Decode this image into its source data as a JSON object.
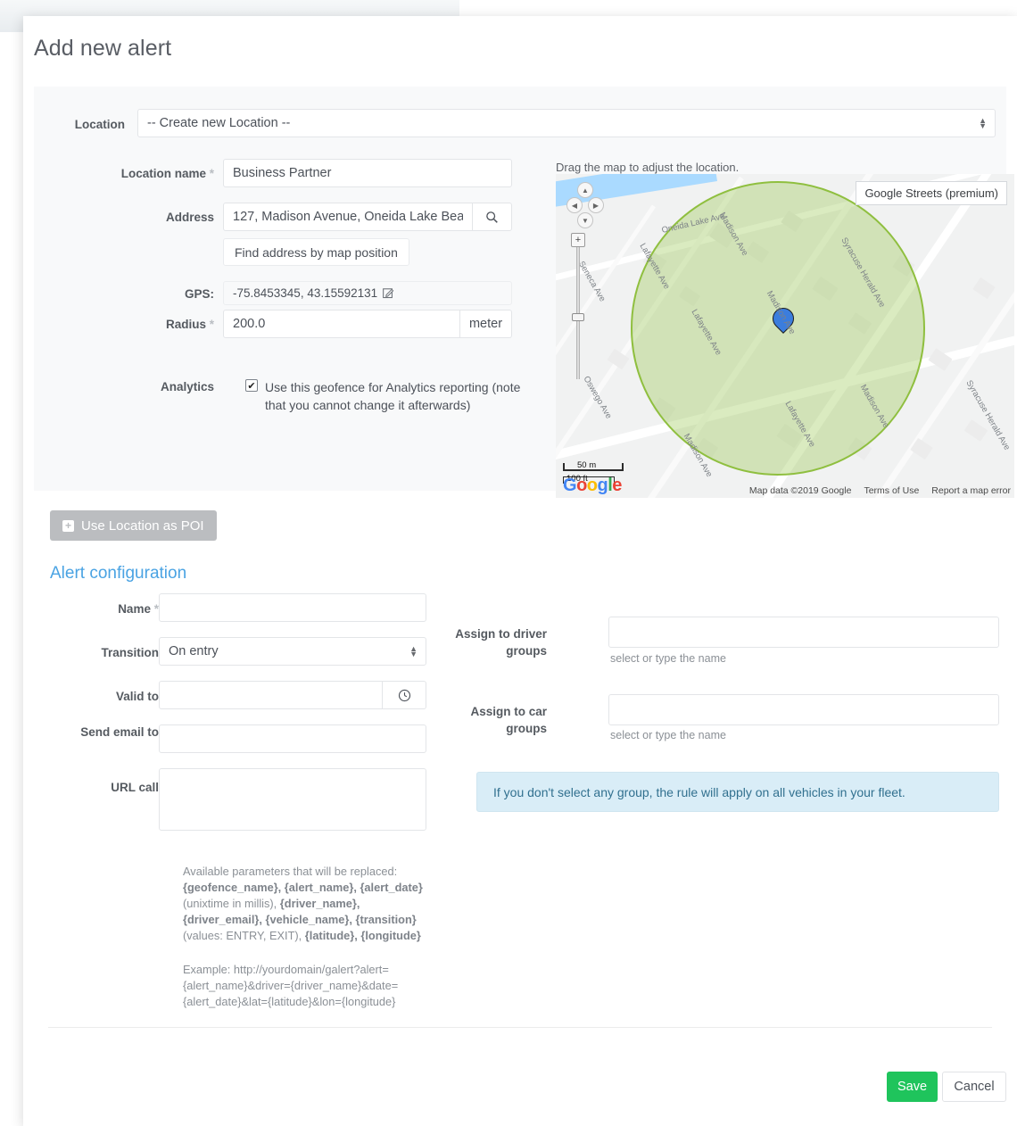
{
  "modal": {
    "title": "Add new alert"
  },
  "location_section": {
    "location_label": "Location",
    "location_select_value": "-- Create new Location --",
    "location_name_label": "Location name",
    "location_name_value": "Business Partner",
    "address_label": "Address",
    "address_value": "127, Madison Avenue, Oneida Lake Bea",
    "find_address_button": "Find address by map position",
    "gps_label": "GPS:",
    "gps_value": "-75.8453345, 43.15592131",
    "radius_label": "Radius",
    "radius_value": "200.0",
    "radius_unit": "meter",
    "analytics_label": "Analytics",
    "analytics_checkbox_checked": "✔",
    "analytics_text": "Use this geofence for Analytics reporting (note that you cannot change it afterwards)",
    "required_marker": "*"
  },
  "map": {
    "hint": "Drag the map to adjust the location.",
    "map_type": "Google Streets (premium)",
    "scale_metric": "50 m",
    "scale_imperial": "100 ft",
    "attribution": "Map data ©2019 Google",
    "terms": "Terms of Use",
    "report": "Report a map error",
    "logo_letters": [
      "G",
      "o",
      "o",
      "g",
      "l",
      "e"
    ],
    "street_labels": [
      "Oneida Lake Ave",
      "Madison Ave",
      "Syracuse Herald Ave",
      "Lafayette Ave",
      "Lafayette Ave",
      "Seneca Ave",
      "Oswego Ave",
      "Madison Ave",
      "Lafayette Ave",
      "Madison Ave",
      "Syracuse Herald Ave",
      "Madison Ave"
    ],
    "circle_fill": "#94c74b",
    "circle_stroke": "#8fbf3f",
    "pin_color": "#3b7ddd",
    "pan_up": "▲",
    "pan_left": "◀",
    "pan_right": "▶",
    "pan_down": "▼",
    "zoom_in": "+"
  },
  "poi_button": {
    "label": "Use Location as POI",
    "icon": "+"
  },
  "alert_config": {
    "section_title": "Alert configuration",
    "name_label": "Name",
    "name_value": "",
    "transition_label": "Transition",
    "transition_value": "On entry",
    "valid_to_label": "Valid to",
    "valid_to_value": "",
    "send_email_label": "Send email to",
    "send_email_value": "",
    "url_call_label": "URL call",
    "url_call_value": "",
    "assign_driver_label": "Assign to driver groups",
    "assign_driver_value": "",
    "assign_driver_help": "select or type the name",
    "assign_car_label": "Assign to car groups",
    "assign_car_value": "",
    "assign_car_help": "select or type the name",
    "info_message": "If you don't select any group, the rule will apply on all vehicles in your fleet.",
    "params_intro": "Available parameters that will be replaced:",
    "params_line1": "{geofence_name}, {alert_name}, {alert_date}",
    "params_line2a": "(unixtime in millis), ",
    "params_line2b": "{driver_name},",
    "params_line3": "{driver_email}, {vehicle_name}, {transition}",
    "params_line4a": "(values: ENTRY, EXIT), ",
    "params_line4b": "{latitude}, {longitude}",
    "example_text": "Example: http://yourdomain/galert?alert={alert_name}&driver={driver_name}&date={alert_date}&lat={latitude}&lon={longitude}",
    "required_marker": "*"
  },
  "footer": {
    "save_label": "Save",
    "cancel_label": "Cancel",
    "save_color": "#1fc45c"
  }
}
